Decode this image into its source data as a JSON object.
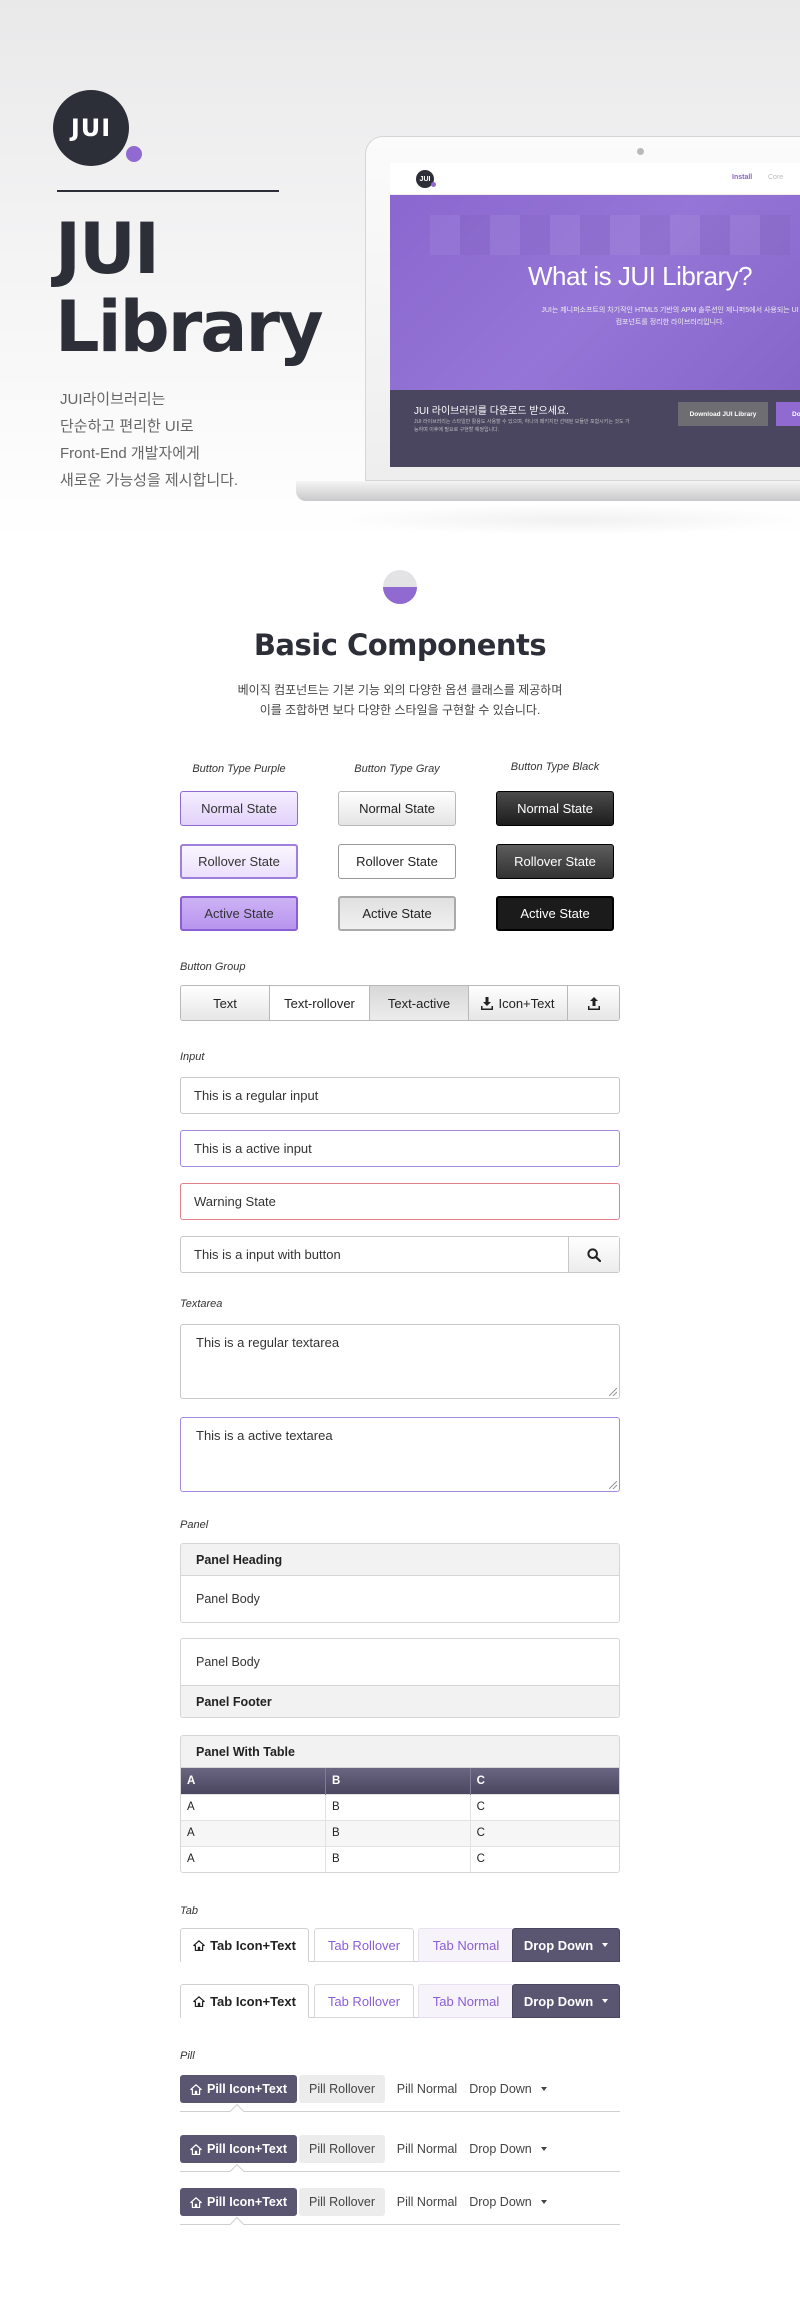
{
  "hero": {
    "logo_text": "JUI",
    "title_lines": [
      "JUI",
      "Library"
    ],
    "desc_lines": [
      "JUI라이브러리는",
      "단순하고 편리한 UI로",
      "Front-End 개발자에게",
      "새로운 가능성을 제시합니다."
    ]
  },
  "laptop": {
    "logo_text": "JUI",
    "nav": [
      "Install",
      "Core"
    ],
    "headline": "What is JUI Library?",
    "subtext": "JUI는 제니퍼소프트의 차기작인 HTML5 기반의 APM 솔루션인 제니퍼5에서 사용되는 UI 컴포넌트를 정리한 라이브러리입니다.",
    "band_title": "JUI 라이브러리를 다운로드 받으세요.",
    "band_sub": "JUI 라이브러리는 스타일만 활용도 사용할 수 있으며, 하나의 패키지만 선택된 모듈만 포함시키는 것도 가능하며 이후에 필요로 구현할 예정입니다.",
    "download_label": "Download JUI Library",
    "second_btn_label": "Dow"
  },
  "basic": {
    "title": "Basic Components",
    "desc_lines": [
      "베이직  컴포넌트는 기본 기능 외의 다양한 옵션 클래스를 제공하며",
      "이를 조합하면 보다 다양한 스타일을 구현할 수 있습니다."
    ]
  },
  "button_types": {
    "columns": [
      "Button Type Purple",
      "Button Type Gray",
      "Button Type Black"
    ],
    "states": [
      "Normal State",
      "Rollover State",
      "Active State"
    ]
  },
  "button_group": {
    "label": "Button Group",
    "items": [
      "Text",
      "Text-rollover",
      "Text-active",
      "Icon+Text"
    ]
  },
  "input": {
    "label": "Input",
    "regular": "This is a regular input",
    "active": "This is a active input",
    "warning": "Warning State",
    "with_button": "This is a input with button"
  },
  "textarea": {
    "label": "Textarea",
    "regular": "This is a regular textarea",
    "active": "This is a active textarea"
  },
  "panel": {
    "label": "Panel",
    "heading": "Panel Heading",
    "body": "Panel Body",
    "body2": "Panel Body",
    "footer": "Panel Footer",
    "table_title": "Panel With Table",
    "table_headers": [
      "A",
      "B",
      "C"
    ],
    "table_rows": [
      [
        "A",
        "B",
        "C"
      ],
      [
        "A",
        "B",
        "C"
      ],
      [
        "A",
        "B",
        "C"
      ]
    ]
  },
  "tab": {
    "label": "Tab",
    "items": [
      "Tab Icon+Text",
      "Tab Rollover",
      "Tab Normal",
      "Drop Down"
    ]
  },
  "pill": {
    "label": "Pill",
    "items": [
      "Pill Icon+Text",
      "Pill Rollover",
      "Pill Normal",
      "Drop Down"
    ]
  },
  "colors": {
    "purple": "#9069d1",
    "dark": "#2d2f38",
    "slate": "#5a5570"
  },
  "icons": [
    "home-icon",
    "download-icon",
    "upload-icon",
    "search-icon",
    "caret-down-icon"
  ]
}
